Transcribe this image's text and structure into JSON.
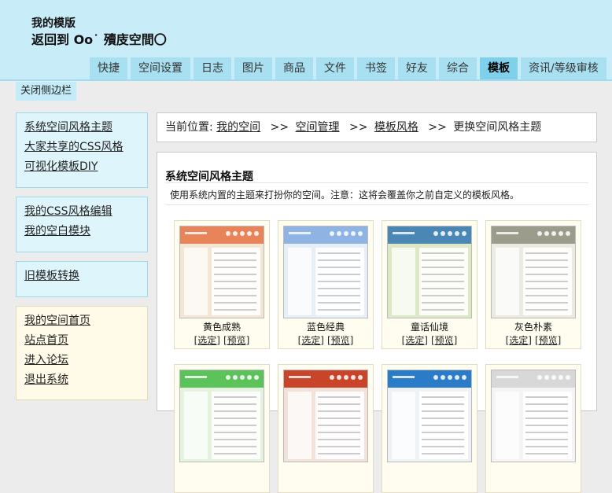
{
  "header": {
    "title": "我的模版",
    "back_text": "返回到 Oo˙ 殰庋空間〇"
  },
  "tabs": [
    {
      "label": "快捷"
    },
    {
      "label": "空间设置"
    },
    {
      "label": "日志"
    },
    {
      "label": "图片"
    },
    {
      "label": "商品"
    },
    {
      "label": "文件"
    },
    {
      "label": "书签"
    },
    {
      "label": "好友"
    },
    {
      "label": "综合"
    },
    {
      "label": "模板",
      "active": true
    },
    {
      "label": "资讯/等级审核"
    }
  ],
  "sidebar": {
    "close_label": "关闭侧边栏",
    "group1": [
      "系统空间风格主题",
      "大家共享的CSS风格",
      "可视化模板DIY"
    ],
    "group2": [
      "我的CSS风格编辑",
      "我的空白模块"
    ],
    "group3": [
      "旧模板转换"
    ],
    "group4": [
      "我的空间首页",
      "站点首页",
      "进入论坛",
      "退出系统"
    ]
  },
  "breadcrumb": {
    "prefix": "当前位置:",
    "links": [
      "我的空间",
      "空间管理",
      "模板风格"
    ],
    "sep": ">>",
    "current": "更换空间风格主题"
  },
  "main": {
    "title": "系统空间风格主题",
    "description": "使用系统内置的主题来打扮你的空间。注意：这将会覆盖你之前自定义的模板风格。",
    "select_label": "[选定]",
    "preview_label": "[预览]",
    "themes": [
      {
        "name": "黄色成熟",
        "top_color": "#e8845a",
        "body_color": "#f3e6d2"
      },
      {
        "name": "蓝色经典",
        "top_color": "#8fb4e4",
        "body_color": "#e6eef8"
      },
      {
        "name": "童话仙境",
        "top_color": "#4b87b4",
        "body_color": "#dbe9c4"
      },
      {
        "name": "灰色朴素",
        "top_color": "#9c9c8c",
        "body_color": "#ebebe2"
      },
      {
        "name": "",
        "top_color": "#5cc25a",
        "body_color": "#e4f2de"
      },
      {
        "name": "",
        "top_color": "#c8452a",
        "body_color": "#f2e2da"
      },
      {
        "name": "",
        "top_color": "#2a7cc8",
        "body_color": "#eef2f6"
      },
      {
        "name": "",
        "top_color": "#d8d8d8",
        "body_color": "#f4f4f4"
      }
    ]
  }
}
